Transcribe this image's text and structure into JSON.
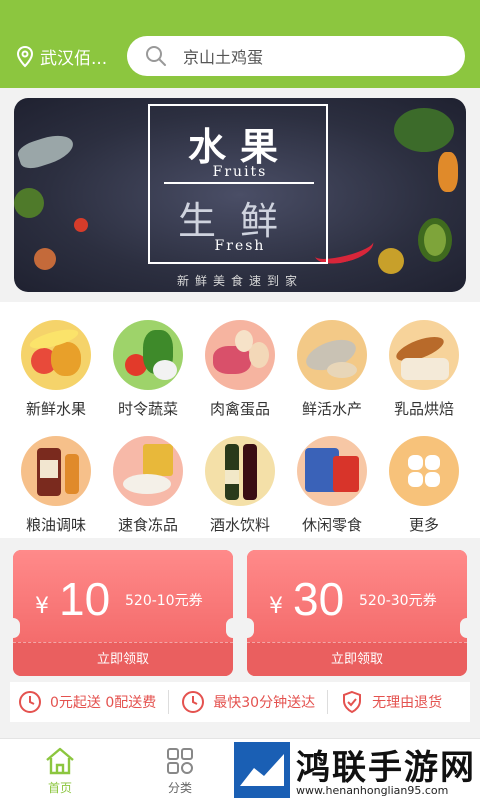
{
  "header": {
    "location": "武汉佰...",
    "search_placeholder": "京山土鸡蛋",
    "bg_color": "#8cc63f"
  },
  "banner": {
    "title_top": "水果",
    "title_top_en": "Fruits",
    "title_bottom": "生鲜",
    "title_bottom_en": "Fresh",
    "tagline": "新鲜美食速到家"
  },
  "categories": [
    {
      "label": "新鲜水果",
      "icon": "fruit-icon",
      "color": "#f5d36a"
    },
    {
      "label": "时令蔬菜",
      "icon": "vegetable-icon",
      "color": "#9ed36a"
    },
    {
      "label": "肉禽蛋品",
      "icon": "meat-icon",
      "color": "#f6b4a0"
    },
    {
      "label": "鲜活水产",
      "icon": "seafood-icon",
      "color": "#f3c987"
    },
    {
      "label": "乳品烘焙",
      "icon": "bakery-icon",
      "color": "#f7d39a"
    },
    {
      "label": "粮油调味",
      "icon": "sauce-icon",
      "color": "#f6c08a"
    },
    {
      "label": "速食冻品",
      "icon": "frozen-food-icon",
      "color": "#f7b9a8"
    },
    {
      "label": "酒水饮料",
      "icon": "wine-icon",
      "color": "#f4e0a8"
    },
    {
      "label": "休闲零食",
      "icon": "snack-icon",
      "color": "#f7c7a5"
    },
    {
      "label": "更多",
      "icon": "more-icon",
      "color": "#f7c27a"
    }
  ],
  "coupons": [
    {
      "currency": "¥",
      "amount": "10",
      "desc": "520-10元券",
      "action": "立即领取"
    },
    {
      "currency": "¥",
      "amount": "30",
      "desc": "520-30元券",
      "action": "立即领取"
    }
  ],
  "promises": [
    {
      "text": "0元起送 0配送费",
      "icon": "clock-icon"
    },
    {
      "text": "最快30分钟送达",
      "icon": "clock-icon"
    },
    {
      "text": "无理由退货",
      "icon": "shield-check-icon"
    }
  ],
  "nav": {
    "home": "首页",
    "category": "分类",
    "active_color": "#8cc63f"
  },
  "watermark": {
    "text": "鸿联手游网",
    "url": "www.henanhonglian95.com"
  }
}
